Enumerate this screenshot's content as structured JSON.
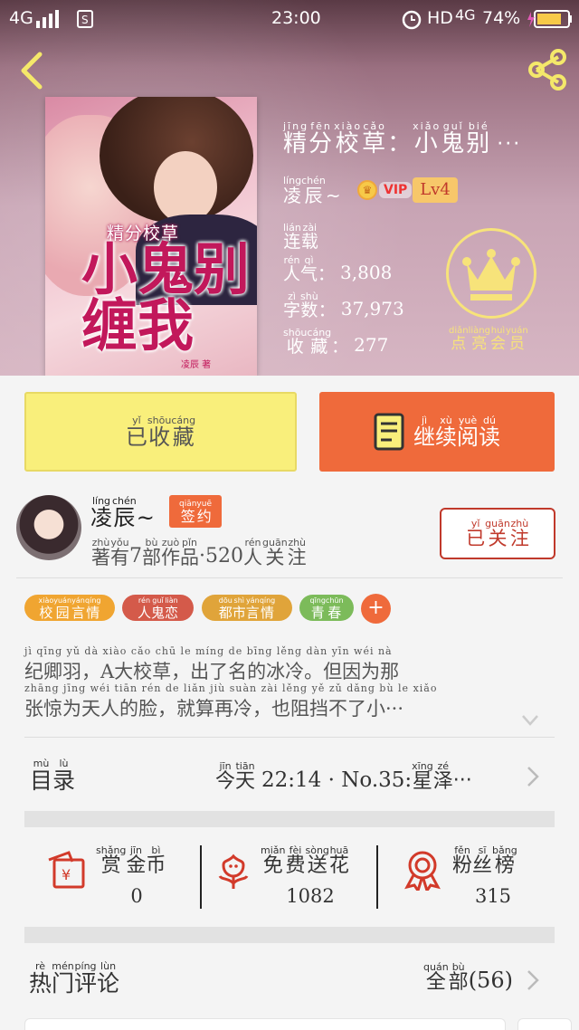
{
  "status_bar": {
    "network": "4G",
    "time": "23:00",
    "hd": "HD",
    "network2": "4G",
    "battery": "74%"
  },
  "book": {
    "title": "精分校草：小鬼别",
    "title_ellipsis": "···",
    "title_pinyin": [
      "jīng",
      "fēn",
      "xiào",
      "cǎo",
      "xiǎo",
      "guǐ",
      "bié"
    ],
    "author": "凌辰~",
    "author_pinyin": [
      "líng",
      "chén"
    ],
    "vip_label": "VIP",
    "level": "Lv4",
    "status": "连载",
    "status_pinyin": [
      "lián",
      "zài"
    ],
    "popularity_label": "人气：",
    "popularity_pinyin": [
      "rén",
      "qì"
    ],
    "popularity": "3,808",
    "words_label": "字数：",
    "words_pinyin": [
      "zì",
      "shù"
    ],
    "words": "37,973",
    "favorites_label": "收藏：",
    "favorites_pinyin": [
      "shōu",
      "cáng"
    ],
    "favorites": "277",
    "membership_label": "点亮会员",
    "membership_pinyin": [
      "diǎn",
      "liàng",
      "huì",
      "yuán"
    ],
    "cover": {
      "small_title": "精分校草",
      "big_title": "小鬼别缠我",
      "author": "凌辰 著"
    }
  },
  "actions": {
    "shelf_label": "已收藏",
    "shelf_pinyin": [
      "yǐ",
      "shōu",
      "cáng"
    ],
    "read_label": "继续阅读",
    "read_pinyin": [
      "jì",
      "xù",
      "yuè",
      "dú"
    ]
  },
  "author_card": {
    "name": "凌辰~",
    "name_pinyin": [
      "líng",
      "chén"
    ],
    "signed_label": "签约",
    "signed_pinyin": [
      "qiān",
      "yuē"
    ],
    "works_prefix": "著有",
    "works_prefix_pinyin": [
      "zhù",
      "yǒu"
    ],
    "works_count": "7",
    "works_suffix": "部作品",
    "works_suffix_pinyin": [
      "bù",
      "zuò",
      "pǐn"
    ],
    "followers": "520",
    "followers_suffix": "人关注",
    "followers_suffix_pinyin": [
      "rén",
      "guān",
      "zhù"
    ],
    "follow_label": "已关注",
    "follow_pinyin": [
      "yǐ",
      "guān",
      "zhù"
    ]
  },
  "tags": [
    {
      "label": "校园言情",
      "pinyin": [
        "xiào",
        "yuán",
        "yán",
        "qíng"
      ],
      "color": "#f0a531"
    },
    {
      "label": "人鬼恋",
      "pinyin": [
        "rén",
        "guǐ",
        "liàn"
      ],
      "color": "#d45a4a"
    },
    {
      "label": "都市言情",
      "pinyin": [
        "dōu",
        "shì",
        "yán",
        "qíng"
      ],
      "color": "#e0a43a"
    },
    {
      "label": "青春",
      "pinyin": [
        "qīng",
        "chūn"
      ],
      "color": "#7cbb5a"
    }
  ],
  "synopsis": {
    "line1": "纪卿羽，A大校草，出了名的冰冷。但因为那",
    "line1_pinyin": "jì qīng yǔ  dà xiào cǎo  chū le míng de bīng lěng  dàn yīn wéi nà",
    "line2": "张惊为天人的脸，就算再冷，也阻挡不了小···",
    "line2_pinyin": "zhāng jīng wéi tiān rén de liǎn  jiù suàn zài lěng  yě zǔ dǎng bù le xiǎo"
  },
  "catalog": {
    "title": "目录",
    "title_pinyin": [
      "mù",
      "lù"
    ],
    "today": "今天",
    "today_pinyin": [
      "jīn",
      "tiān"
    ],
    "time": "22:14",
    "chapter": "No.35:",
    "chapter_name": "星泽",
    "chapter_pinyin": [
      "xīng",
      "zé"
    ],
    "ellipsis": "···"
  },
  "rewards": [
    {
      "label": "赏金币",
      "pinyin": [
        "shǎng",
        "jīn",
        "bì"
      ],
      "value": "0",
      "icon": "coin-envelope-icon"
    },
    {
      "label": "免费送花",
      "pinyin": [
        "miǎn",
        "fèi",
        "sòng",
        "huā"
      ],
      "value": "1082",
      "icon": "flower-icon"
    },
    {
      "label": "粉丝榜",
      "pinyin": [
        "fěn",
        "sī",
        "bǎng"
      ],
      "value": "315",
      "icon": "medal-icon"
    }
  ],
  "comments": {
    "title": "热门评论",
    "title_pinyin": [
      "rè",
      "mén",
      "píng",
      "lùn"
    ],
    "all_label": "全部",
    "all_pinyin": [
      "quán",
      "bù"
    ],
    "count": "(56)"
  },
  "colors": {
    "accent": "#ef6a3b",
    "shelf": "#f9ef7b",
    "follow": "#c0392b",
    "crown": "#f7e37a"
  }
}
